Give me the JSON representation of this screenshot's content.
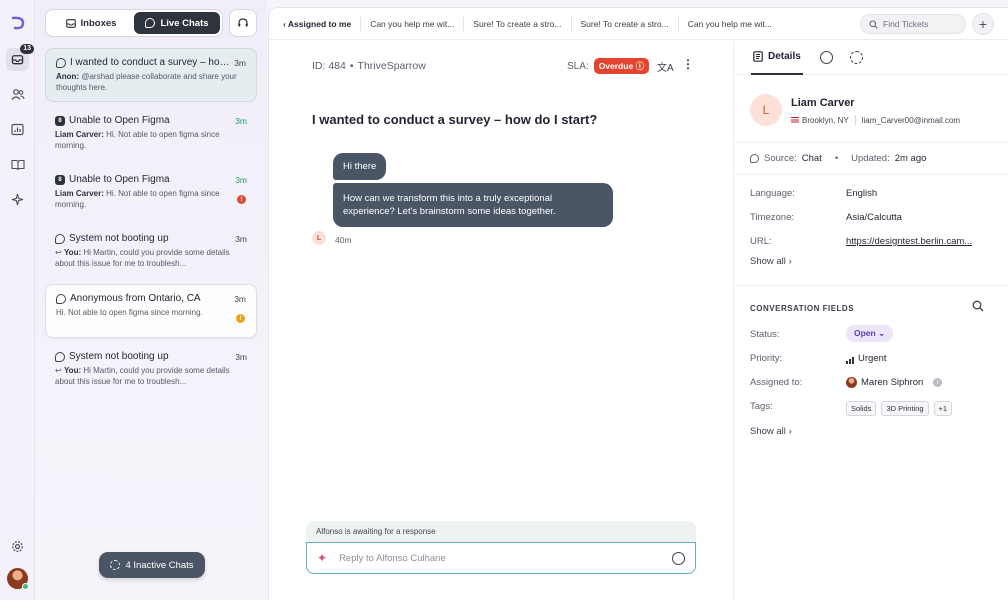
{
  "rail": {
    "inbox_badge": "13"
  },
  "list": {
    "toggle": {
      "inboxes": "Inboxes",
      "live_chats": "Live Chats"
    },
    "items": [
      {
        "title": "I wanted to conduct a survey – how do I start?",
        "time": "3m",
        "time_color": "default",
        "author": "Anon:",
        "preview": " @arshad  please collaborate and share your thoughts here.",
        "icon": "chat-bubble-icon",
        "style": "selected"
      },
      {
        "title": "Unable to Open Figma",
        "time": "3m",
        "time_color": "green",
        "author": "Liam Carver:",
        "preview": " Hi. Not able to open figma since morning.",
        "icon": "figma-icon",
        "style": "plain"
      },
      {
        "title": "Unable to Open Figma",
        "time": "3m",
        "time_color": "green",
        "author": "Liam Carver:",
        "preview": " Hi. Not able to open figma since morning.",
        "icon": "figma-icon",
        "style": "plain",
        "indicator": "red"
      },
      {
        "title": "System not booting up",
        "time": "3m",
        "time_color": "default",
        "author": "You:",
        "preview": " Hi Martin, could you provide some details about this issue for me to troublesh...",
        "icon": "chat-bubble-icon",
        "style": "plain",
        "reply": true
      },
      {
        "title": "Anonymous from Ontario, CA",
        "time": "3m",
        "time_color": "default",
        "author": "",
        "preview": "Hi. Not able to open figma since morning.",
        "icon": "chat-bubble-icon",
        "style": "card",
        "indicator": "orange"
      },
      {
        "title": "System not booting up",
        "time": "3m",
        "time_color": "default",
        "author": "You:",
        "preview": " Hi Martin, could you provide some details about this issue for me to troublesh...",
        "icon": "chat-bubble-icon",
        "style": "plain",
        "reply": true
      }
    ],
    "inactive_label": "4 Inactive Chats"
  },
  "tabs": [
    "Assigned to me",
    "Can you help me wit...",
    "Sure! To create a stro...",
    "Sure! To create a stro...",
    "Can you help me wit..."
  ],
  "search": {
    "placeholder": "Find Tickets"
  },
  "conversation": {
    "id": "ID: 484",
    "sep": "•",
    "company": "ThriveSparrow",
    "sla_label": "SLA:",
    "sla_status": "Overdue",
    "subject": "I wanted to conduct a survey – how do I start?",
    "messages": [
      "Hi there",
      "How can we transform this into a truly exceptional experience? Let's brainstorm some ideas together."
    ],
    "avatar_initial": "L",
    "message_time": "40m",
    "awaiting": "Alfonso is awaiting for a response",
    "reply_placeholder": "Reply to Alfonso Culhane"
  },
  "details": {
    "tab_label": "Details",
    "contact": {
      "initial": "L",
      "name": "Liam Carver",
      "location": "Brooklyn, NY",
      "email": "liam_Carver00@inmail.com"
    },
    "source_label": "Source:",
    "source_value": "Chat",
    "sep": "•",
    "updated_label": "Updated:",
    "updated_value": "2m ago",
    "language_label": "Language:",
    "language_value": "English",
    "timezone_label": "Timezone:",
    "timezone_value": "Asia/Calcutta",
    "url_label": "URL:",
    "url_value": "https://designtest.berlin.cam...",
    "show_all": "Show all",
    "conv_fields_title": "CONVERSATION FIELDS",
    "status_label": "Status:",
    "status_value": "Open",
    "priority_label": "Priority:",
    "priority_value": "Urgent",
    "assigned_label": "Assigned to:",
    "assigned_value": "Maren Siphron",
    "tags_label": "Tags:",
    "tags": [
      "Solids",
      "3D Printing",
      "+1"
    ],
    "show_all_2": "Show all"
  },
  "colors": {
    "accent_dark": "#2e333d",
    "bubble": "#4a5566",
    "overdue": "#e3442f",
    "status_open_bg": "#ece6f8",
    "reply_border": "#5fb2b8"
  }
}
